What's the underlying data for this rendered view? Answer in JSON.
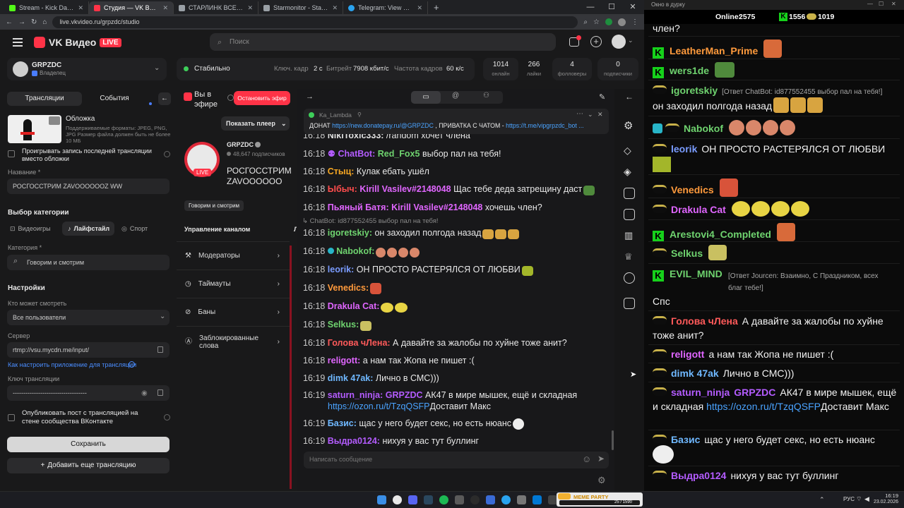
{
  "browser": {
    "tabs": [
      {
        "title": "Stream - Kick Dashboard",
        "color": "#53fc18"
      },
      {
        "title": "Студия — VK Видео Live",
        "color": "#ff3347",
        "active": true
      },
      {
        "title": "СТАРЛИНК ВСЕ — мы прогр...",
        "color": "#9aa0a6"
      },
      {
        "title": "Starmonitor - Starlink Tracker",
        "color": "#9aa0a6"
      },
      {
        "title": "Telegram: View @BotovcdX",
        "color": "#2aa3ef"
      }
    ],
    "url": "live.vkvideo.ru/grpzdc/studio"
  },
  "header": {
    "logo_text": "VK Видео",
    "logo_badge": "LIVE",
    "search_placeholder": "Поиск"
  },
  "channel_card": {
    "name": "GRPZDC",
    "role": "Владелец"
  },
  "stream_status": {
    "state": "Стабильно",
    "keyframe_label": "Ключ. кадр",
    "keyframe_value": "2 с",
    "bitrate_label": "Битрейт",
    "bitrate_value": "7908 кбит/с",
    "fps_label": "Частота кадров",
    "fps_value": "60 к/с"
  },
  "stats": [
    {
      "value": "1014",
      "label": "онлайн"
    },
    {
      "value": "266",
      "label": "лайки"
    },
    {
      "value": "4",
      "label": "фолловеры"
    },
    {
      "value": "0",
      "label": "подписчики"
    }
  ],
  "left": {
    "tab_streams": "Трансляции",
    "tab_events": "События",
    "cover_title": "Обложка",
    "cover_desc": "Поддерживаемые форматы: JPEG, PNG, JPG Размер файла должен быть не более 10 МБ",
    "replay_checkbox": "Проигрывать запись последней трансляции вместо обложки",
    "name_label": "Название *",
    "name_value": "РОСГОССТРИМ ZAVOOOOOOZ WW",
    "category_title": "Выбор категории",
    "category_tabs": [
      "Видеоигры",
      "Лайфстайл",
      "Спорт"
    ],
    "category_label": "Категория *",
    "category_value": "Говорим и смотрим",
    "settings_title": "Настройки",
    "who_label": "Кто может смотреть",
    "who_value": "Все пользователи",
    "server_label": "Сервер",
    "server_value": "rtmp://vsu.mycdn.me/input/",
    "howto_link": "Как настроить приложение для трансляции",
    "key_label": "Ключ трансляции",
    "key_value": "-----------------------------------",
    "publish_checkbox": "Опубликовать пост с трансляцией на стене сообщества ВКонтакте",
    "save_button": "Сохранить",
    "add_button": "Добавить еще трансляцию"
  },
  "middle": {
    "on_air": "Вы в эфире",
    "stop_button": "Остановить эфир",
    "show_player": "Показать плеер",
    "channel_name": "GRPZDC",
    "subscribers": "48,647 подписчиков",
    "stream_title": "РОСГОССТРИМ ZAVOOOOOOZ...",
    "live_badge": "LIVE",
    "category_chip": "Говорим и смотрим",
    "manage_title": "Управление каналом",
    "menu": [
      "Модераторы",
      "Таймауты",
      "Баны",
      "Заблокированные слова"
    ]
  },
  "chat": {
    "pinned_user": "Ka_Lambda",
    "pinned_text_a": "ДОНАТ ",
    "pinned_link_a": "https://new.donatepay.ru/@GRPZDC",
    "pinned_text_b": " , ПРИВАТКА С ЧАТОМ - ",
    "pinned_link_b": "https://t.me/vipgrpzdc_bot ...",
    "reply_preview": "ChatBot: id877552455 выбор пал на тебя!",
    "input_placeholder": "Написать сообщение",
    "messages": [
      {
        "time": "16:18",
        "user": "NikiToxic333:",
        "color": "#e0e0e0",
        "text": " /random хочет члена"
      },
      {
        "time": "16:18",
        "user": "ChatBot:",
        "color": "#b45cff",
        "text": "",
        "mention": "Red_Fox5",
        "after": " выбор пал на тебя!"
      },
      {
        "time": "16:18",
        "user": "Стыц:",
        "color": "#f5a623",
        "text": " Кулак ебать ушёл"
      },
      {
        "time": "16:18",
        "user": "Ыбыч:",
        "color": "#ff4d4d",
        "text": "",
        "mention": "Kirill Vasilev#2148048",
        "after": " Щас тебе деда затрещину даст"
      },
      {
        "time": "16:18",
        "user": "Пьяный Батя:",
        "color": "#e066ff",
        "text": "",
        "mention": "Kirill Vasilev#2148048",
        "after": " хочешь член?"
      },
      {
        "time": "16:18",
        "user": "igoretskiy:",
        "color": "#6fd36f",
        "text": " он заходил полгода назад"
      },
      {
        "time": "16:18",
        "user": "Nabokof:",
        "color": "#6fd36f",
        "text": ""
      },
      {
        "time": "16:18",
        "user": "leorik:",
        "color": "#7a9cff",
        "text": " ОН ПРОСТО РАСТЕРЯЛСЯ ОТ ЛЮБВИ"
      },
      {
        "time": "16:18",
        "user": "Venedics:",
        "color": "#ff9a3c",
        "text": ""
      },
      {
        "time": "16:18",
        "user": "Drakula Cat:",
        "color": "#e066ff",
        "text": ""
      },
      {
        "time": "16:18",
        "user": "Selkus:",
        "color": "#6fd36f",
        "text": ""
      },
      {
        "time": "16:18",
        "user": "Голова чЛена:",
        "color": "#ff5a5a",
        "text": " А давайте за жалобы по хуйне тоже анит?"
      },
      {
        "time": "16:18",
        "user": "religott:",
        "color": "#e066ff",
        "text": " а нам так Жопа не пишет :("
      },
      {
        "time": "16:19",
        "user": "dimk 47ak:",
        "color": "#6fb8ff",
        "text": " Лично в СМС)))"
      },
      {
        "time": "16:19",
        "user": "saturn_ninja:",
        "color": "#b45cff",
        "text": "",
        "mention": "GRPZDC",
        "after": " АК47 в мире мышек, ещё и складная",
        "link": "https://ozon.ru/t/TzqQSFP",
        "after2": "Доставит Макс"
      },
      {
        "time": "16:19",
        "user": "Базис:",
        "color": "#6fb8ff",
        "text": " щас у него будет секс, но есть нюанс"
      },
      {
        "time": "16:19",
        "user": "Выдра0124:",
        "color": "#b45cff",
        "text": " нихуя у вас тут буллинг"
      }
    ]
  },
  "right_chat": {
    "window_title": "Окно в дурку",
    "online_label": "Online:",
    "online_value": "2575",
    "kick_count": "1556",
    "other_count": "1019",
    "first_line": "член?",
    "messages": [
      {
        "badge": "kick",
        "user": "LeatherMan_Prime",
        "color": "#ff9a3c",
        "text": ""
      },
      {
        "badge": "kick",
        "user": "wers1de",
        "color": "#6fd36f",
        "text": ""
      },
      {
        "badge": "ban",
        "user": "igoretskiy",
        "color": "#6fd36f",
        "reply": "[Ответ ChatBot: id877552455 выбор пал на тебя!]",
        "text": "он заходил полгода назад"
      },
      {
        "badge": "ban",
        "user": "Nabokof",
        "color": "#6fd36f",
        "text": ""
      },
      {
        "badge": "ban",
        "user": "leorik",
        "color": "#7a9cff",
        "text": "ОН ПРОСТО РАСТЕРЯЛСЯ ОТ ЛЮБВИ"
      },
      {
        "badge": "ban",
        "user": "Venedics",
        "color": "#ff9a3c",
        "text": ""
      },
      {
        "badge": "ban",
        "user": "Drakula Cat",
        "color": "#e066ff",
        "text": ""
      },
      {
        "badge": "kick",
        "user": "Arestovi4_Completed",
        "color": "#6fd36f",
        "text": ""
      },
      {
        "badge": "ban",
        "user": "Selkus",
        "color": "#6fd36f",
        "text": ""
      },
      {
        "badge": "kick",
        "user": "EVIL_MIND",
        "color": "#6fd36f",
        "reply": "[Ответ Jourcen: Взаимно, С Праздником, всех благ тебе!]",
        "text": "Спс"
      },
      {
        "badge": "ban",
        "user": "Голова чЛена",
        "color": "#ff5a5a",
        "text": "А давайте за жалобы по хуйне тоже анит?"
      },
      {
        "badge": "ban",
        "user": "religott",
        "color": "#e066ff",
        "text": "а нам так Жопа не пишет :("
      },
      {
        "badge": "ban",
        "user": "dimk 47ak",
        "color": "#6fb8ff",
        "text": "Лично в СМС)))"
      },
      {
        "badge": "ban",
        "user": "saturn_ninja",
        "color": "#b45cff",
        "mention": "GRPZDC",
        "text": "АК47 в мире мышек, ещё и складная",
        "link": "https://ozon.ru/t/TzqQSFP",
        "after": "Доставит Макс"
      },
      {
        "badge": "ban",
        "user": "Базис",
        "color": "#6fb8ff",
        "text": "щас у него будет секс, но есть нюанс"
      },
      {
        "badge": "ban",
        "user": "Выдра0124",
        "color": "#b45cff",
        "text": "нихуя у вас тут буллинг"
      }
    ]
  },
  "taskbar": {
    "widget": "MEME PARTY",
    "widget_counter": "25 / 1590",
    "lang": "РУС",
    "time": "16:19",
    "date": "23.02.2026"
  },
  "colors": {
    "accent": "#ff3347",
    "kick_green": "#16d11b",
    "link": "#4aa3ff"
  }
}
